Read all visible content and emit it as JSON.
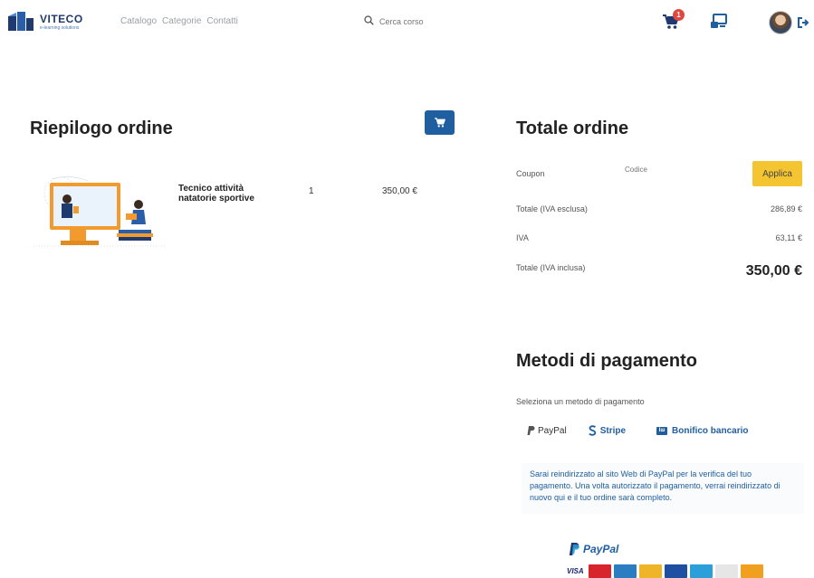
{
  "header": {
    "logo_name": "VITECO",
    "logo_tagline": "e-learning solutions",
    "nav": [
      "Catalogo",
      "Categorie",
      "Contatti"
    ],
    "search_placeholder": "Cerca corso",
    "cart_count": "1"
  },
  "summary": {
    "title": "Riepilogo ordine",
    "items": [
      {
        "name": "Tecnico attività natatorie sportive",
        "qty": "1",
        "price": "350,00 €"
      }
    ]
  },
  "totals": {
    "title": "Totale ordine",
    "coupon_label": "Coupon",
    "coupon_placeholder": "Codice",
    "apply_label": "Applica",
    "rows": [
      {
        "label": "Totale (IVA esclusa)",
        "value": "286,89 €"
      },
      {
        "label": "IVA",
        "value": "63,11 €"
      },
      {
        "label": "Totale (IVA inclusa)",
        "value": "350,00 €"
      }
    ]
  },
  "payment": {
    "title": "Metodi di pagamento",
    "subtitle": "Seleziona un metodo di pagamento",
    "tabs": [
      "PayPal",
      "Stripe",
      "Bonifico bancario"
    ],
    "bank_badge": "Iш",
    "info": "Sarai reindirizzato al sito Web di PayPal per la verifica del tuo pagamento. Una volta autorizzato il pagamento, verrai reindirizzato di nuovo qui e il tuo ordine sarà completo.",
    "paypal_logo": "PayPal",
    "visa_label": "VISA",
    "card_colors": [
      "#d8242c",
      "#2a7dc0",
      "#f0b429",
      "#1f4fa0",
      "#2b9fd9",
      "#e6e6e6",
      "#f0a01e"
    ]
  },
  "colors": {
    "primary": "#1f5fa0",
    "accent": "#f4c431",
    "badge": "#e0473f"
  }
}
